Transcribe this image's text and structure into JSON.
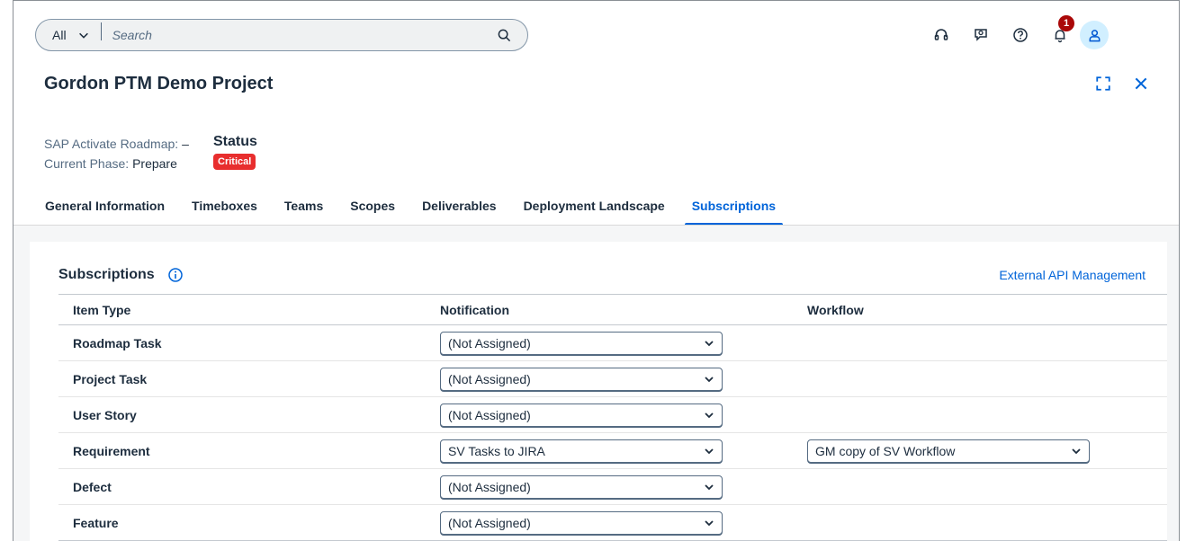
{
  "shell": {
    "scope_label": "All",
    "search_placeholder": "Search",
    "notification_count": "1",
    "icons": [
      "headset-icon",
      "chat-icon",
      "help-icon",
      "bell-icon",
      "user-icon"
    ]
  },
  "header": {
    "title": "Gordon PTM Demo Project",
    "roadmap_label": "SAP Activate Roadmap:",
    "roadmap_value": "–",
    "phase_label": "Current Phase:",
    "phase_value": "Prepare",
    "status_label": "Status",
    "status_value": "Critical"
  },
  "tabs": [
    {
      "label": "General Information"
    },
    {
      "label": "Timeboxes"
    },
    {
      "label": "Teams"
    },
    {
      "label": "Scopes"
    },
    {
      "label": "Deliverables"
    },
    {
      "label": "Deployment Landscape"
    },
    {
      "label": "Subscriptions",
      "active": true
    }
  ],
  "subscriptions": {
    "title": "Subscriptions",
    "external_link": "External API Management",
    "columns": [
      "Item Type",
      "Notification",
      "Workflow"
    ],
    "rows": [
      {
        "item_type": "Roadmap Task",
        "notification": "(Not Assigned)",
        "workflow": ""
      },
      {
        "item_type": "Project Task",
        "notification": "(Not Assigned)",
        "workflow": ""
      },
      {
        "item_type": "User Story",
        "notification": "(Not Assigned)",
        "workflow": ""
      },
      {
        "item_type": "Requirement",
        "notification": "SV Tasks to JIRA",
        "workflow": "GM copy of SV Workflow"
      },
      {
        "item_type": "Defect",
        "notification": "(Not Assigned)",
        "workflow": ""
      },
      {
        "item_type": "Feature",
        "notification": "(Not Assigned)",
        "workflow": ""
      }
    ]
  },
  "colors": {
    "accent": "#0064d9",
    "critical": "#e82e2e",
    "badge": "#aa0808"
  }
}
